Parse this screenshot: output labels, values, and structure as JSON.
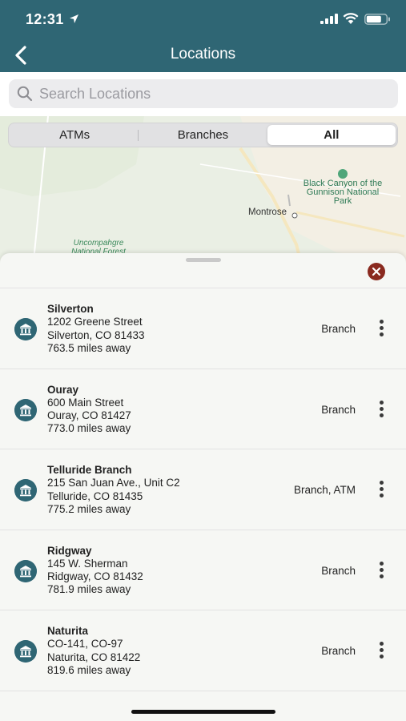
{
  "status": {
    "time": "12:31"
  },
  "nav": {
    "title": "Locations"
  },
  "search": {
    "placeholder": "Search Locations",
    "value": ""
  },
  "segments": [
    {
      "label": "ATMs",
      "active": false
    },
    {
      "label": "Branches",
      "active": false
    },
    {
      "label": "All",
      "active": true
    }
  ],
  "map": {
    "labels": {
      "park": "Black Canyon of the Gunnison National Park",
      "town": "Montrose",
      "forest": "Uncompahgre National Forest"
    }
  },
  "locations": [
    {
      "name": "Silverton",
      "address": "1202 Greene Street",
      "city": "Silverton, CO 81433",
      "distance": "763.5 miles away",
      "type": "Branch"
    },
    {
      "name": "Ouray",
      "address": "600 Main Street",
      "city": "Ouray, CO 81427",
      "distance": "773.0 miles away",
      "type": "Branch"
    },
    {
      "name": "Telluride Branch",
      "address": "215 San Juan Ave., Unit C2",
      "city": "Telluride, CO 81435",
      "distance": "775.2 miles away",
      "type": "Branch, ATM"
    },
    {
      "name": "Ridgway",
      "address": "145 W. Sherman",
      "city": "Ridgway, CO 81432",
      "distance": "781.9 miles away",
      "type": "Branch"
    },
    {
      "name": "Naturita",
      "address": "CO-141, CO-97",
      "city": "Naturita, CO 81422",
      "distance": "819.6 miles away",
      "type": "Branch"
    }
  ],
  "colors": {
    "brand": "#2f6674",
    "close": "#8a2a1f"
  }
}
